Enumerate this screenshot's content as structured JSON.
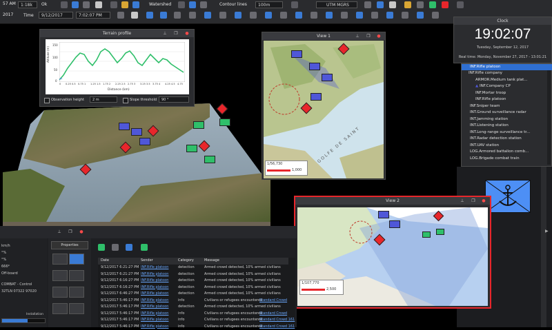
{
  "toolbar": {
    "scale": "1:18k",
    "ok_label": "Ok",
    "time_label": "Time",
    "date_value": "9/12/2017",
    "time_value": "7:02:07 PM",
    "watershed_label": "Watershed",
    "contour_lines_label": "Contour lines",
    "contour_interval": "100m",
    "grid_label": "UTM MGRS",
    "top_left_time": "57 AM",
    "top_left_year": "2017"
  },
  "terrain_profile": {
    "title": "Terrain profile",
    "ylabel": "Altitude (m)",
    "xlabel": "Distance (km)",
    "observation_height_label": "Observation height",
    "observation_height_value": "2 m",
    "slope_threshold_label": "Slope threshold",
    "slope_threshold_value": "90 °",
    "ytick_labels": [
      "150",
      "100",
      "50",
      "0"
    ],
    "xtick_labels": [
      "0",
      "0.25",
      "0.5",
      "0.75",
      "1",
      "1.25",
      "1.5",
      "1.75",
      "2",
      "2.25",
      "2.5",
      "2.75",
      "3",
      "3.25",
      "3.5",
      "3.75",
      "4",
      "4.25",
      "4.5",
      "4.75"
    ]
  },
  "view1": {
    "title": "View 1",
    "scale_text": "1/56,730",
    "scale_bar_label": "1,000",
    "map_labels": [
      "GOLFE DE SAINT"
    ]
  },
  "view2": {
    "title": "View 2",
    "scale_text": "1/107,770",
    "scale_bar_label": "2,500"
  },
  "clock": {
    "title": "Clock",
    "time": "19:02:07",
    "date": "Tuesday, September 12, 2017",
    "realtime": "Real time: Monday, November 27, 2017 - 13:01:21"
  },
  "orbat": {
    "items": [
      {
        "label": "INF.Rifle platoon",
        "selected": true
      },
      {
        "label": "INF.Rifle company",
        "selected": false
      },
      {
        "label": "ARMOR.Medium tank plat...",
        "selected": false
      },
      {
        "label": "INF.Company CP",
        "selected": false
      },
      {
        "label": "INF.Mortar troop",
        "selected": false
      },
      {
        "label": "INF.Rifle platoon",
        "selected": false
      },
      {
        "label": "INF.Sniper team",
        "selected": false
      },
      {
        "label": "INT.Ground surveillance radar",
        "selected": false
      },
      {
        "label": "INT.Jamming station",
        "selected": false
      },
      {
        "label": "INT.Listening station",
        "selected": false
      },
      {
        "label": "INT.Long-range surveillance tr...",
        "selected": false
      },
      {
        "label": "INT.Radar detection station",
        "selected": false
      },
      {
        "label": "INT.UAV station",
        "selected": false
      },
      {
        "label": "LOG.Armored battalion comb...",
        "selected": false
      },
      {
        "label": "LOG.Brigade combat train",
        "selected": false
      }
    ]
  },
  "left_info": {
    "lines": [
      "km/h",
      "°%",
      "°%",
      "666*",
      "Off-board",
      "COMBAT - Control",
      "32TLN 07322 97020"
    ],
    "installation_label": "Installation"
  },
  "properties": {
    "label": "Properties"
  },
  "event_log": {
    "headers": [
      "Date",
      "Sender",
      "Category",
      "Message"
    ],
    "rows": [
      {
        "date": "9/12/2017 6:21:27 PM",
        "sender": "INF.Rifle platoon",
        "category": "detection",
        "message": "Armed crowd detected, 10% armed civilians",
        "extra": ""
      },
      {
        "date": "9/12/2017 6:21:27 PM",
        "sender": "INF.Rifle platoon",
        "category": "detection",
        "message": "Armed crowd detected, 10% armed civilians",
        "extra": ""
      },
      {
        "date": "9/12/2017 6:16:27 PM",
        "sender": "INF.Rifle platoon",
        "category": "detection",
        "message": "Armed crowd detected, 10% armed civilians",
        "extra": ""
      },
      {
        "date": "9/12/2017 6:16:27 PM",
        "sender": "INF.Rifle platoon",
        "category": "detection",
        "message": "Armed crowd detected, 10% armed civilians",
        "extra": ""
      },
      {
        "date": "9/12/2017 6:46:27 PM",
        "sender": "INF.Rifle platoon",
        "category": "detection",
        "message": "Armed crowd detected, 10% armed civilians",
        "extra": ""
      },
      {
        "date": "9/12/2017 5:46:17 PM",
        "sender": "INF.Rifle platoon",
        "category": "info",
        "message": "Civilians or refugees encountered",
        "extra": "Standard Crowd"
      },
      {
        "date": "9/12/2017 5:46:17 PM",
        "sender": "INF.Rifle platoon",
        "category": "detection",
        "message": "Armed crowd detected, 10% armed civilians",
        "extra": ""
      },
      {
        "date": "9/12/2017 5:46:17 PM",
        "sender": "INF.Rifle platoon",
        "category": "info",
        "message": "Civilians or refugees encountered",
        "extra": "Standard Crowd"
      },
      {
        "date": "9/12/2017 5:46:17 PM",
        "sender": "INF.Rifle platoon",
        "category": "info",
        "message": "Civilians or refugees encountered",
        "extra": "Standard Crowd 161"
      },
      {
        "date": "9/12/2017 5:46:17 PM",
        "sender": "INF.Rifle platoon",
        "category": "info",
        "message": "Civilians or refugees encountered",
        "extra": "Standard Crowd 161"
      }
    ]
  },
  "colors": {
    "hostile": "#e8262b",
    "friendly": "#4f57d8",
    "neutral": "#2fbf6a",
    "selection": "#2f6fd1",
    "link": "#6ba9ff"
  }
}
